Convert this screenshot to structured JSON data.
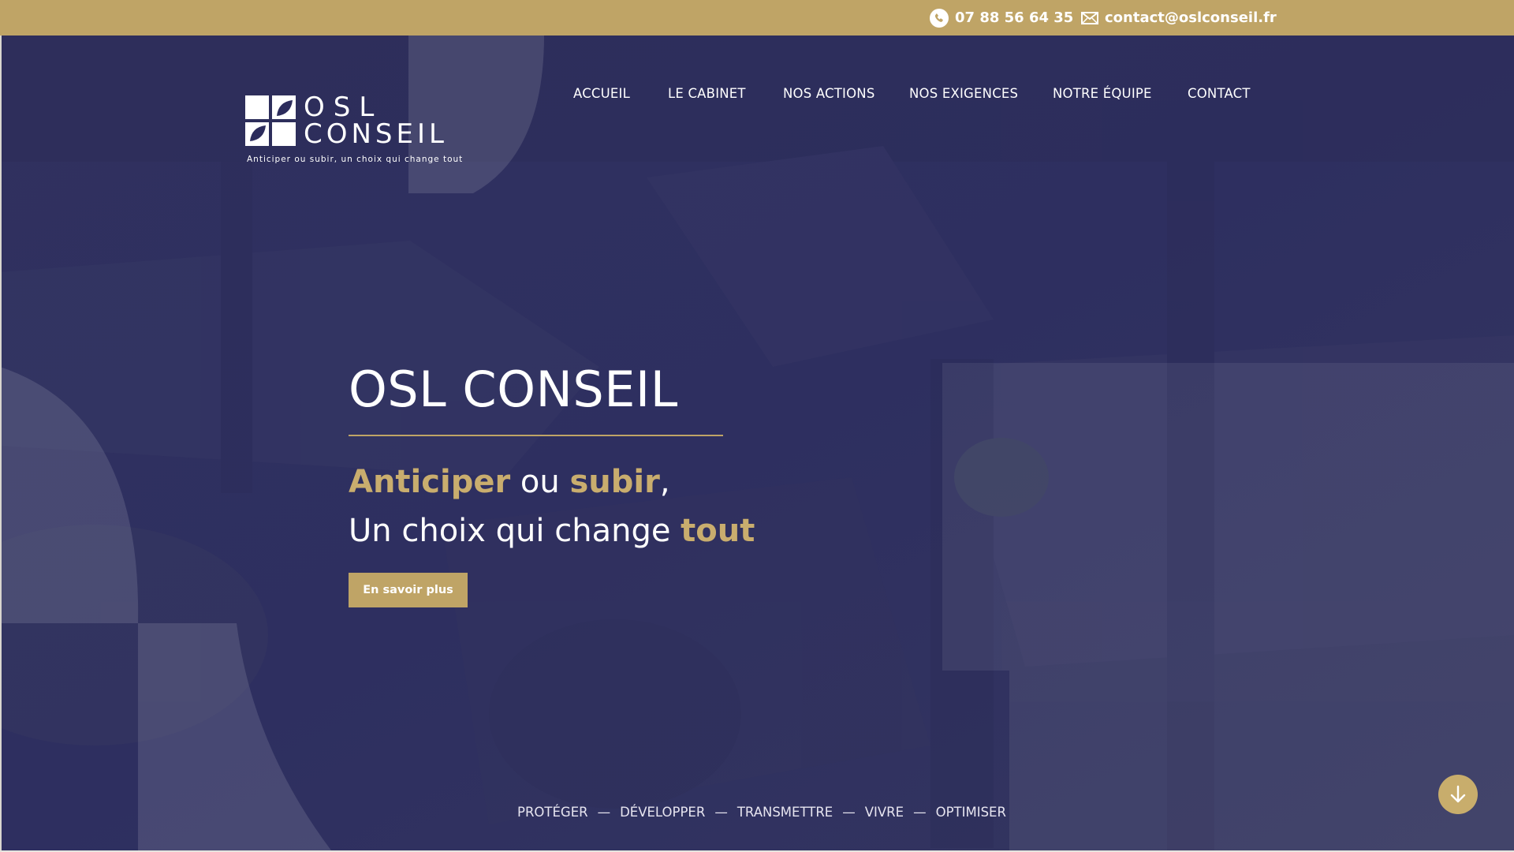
{
  "topbar": {
    "phone": "07 88 56 64 35",
    "email": "contact@oslconseil.fr",
    "phone_icon": "phone-icon",
    "email_icon": "mail-icon",
    "background_color": "#bfa466"
  },
  "header": {
    "logo": {
      "line1": "OSL",
      "line2": "CONSEIL",
      "tagline": "Anticiper ou subir, un choix qui change tout"
    },
    "nav": [
      {
        "label": "ACCUEIL"
      },
      {
        "label": "LE CABINET"
      },
      {
        "label": "NOS ACTIONS"
      },
      {
        "label": "NOS EXIGENCES"
      },
      {
        "label": "NOTRE ÉQUIPE"
      },
      {
        "label": "CONTACT"
      }
    ]
  },
  "hero": {
    "title": "OSL CONSEIL",
    "subtitle": {
      "w1": "Anticiper",
      "w2": " ou ",
      "w3": "subir",
      "w4": ",",
      "w5": "Un choix qui change ",
      "w6": "tout"
    },
    "cta_label": "En savoir plus",
    "pillars": [
      "PROTÉGER",
      "DÉVELOPPER",
      "TRANSMETTRE",
      "VIVRE",
      "OPTIMISER"
    ],
    "pillar_separator": "—",
    "scroll_icon": "arrow-down-icon",
    "accent_color": "#c9ad6e",
    "overlay_color": "#2c2c5c"
  }
}
